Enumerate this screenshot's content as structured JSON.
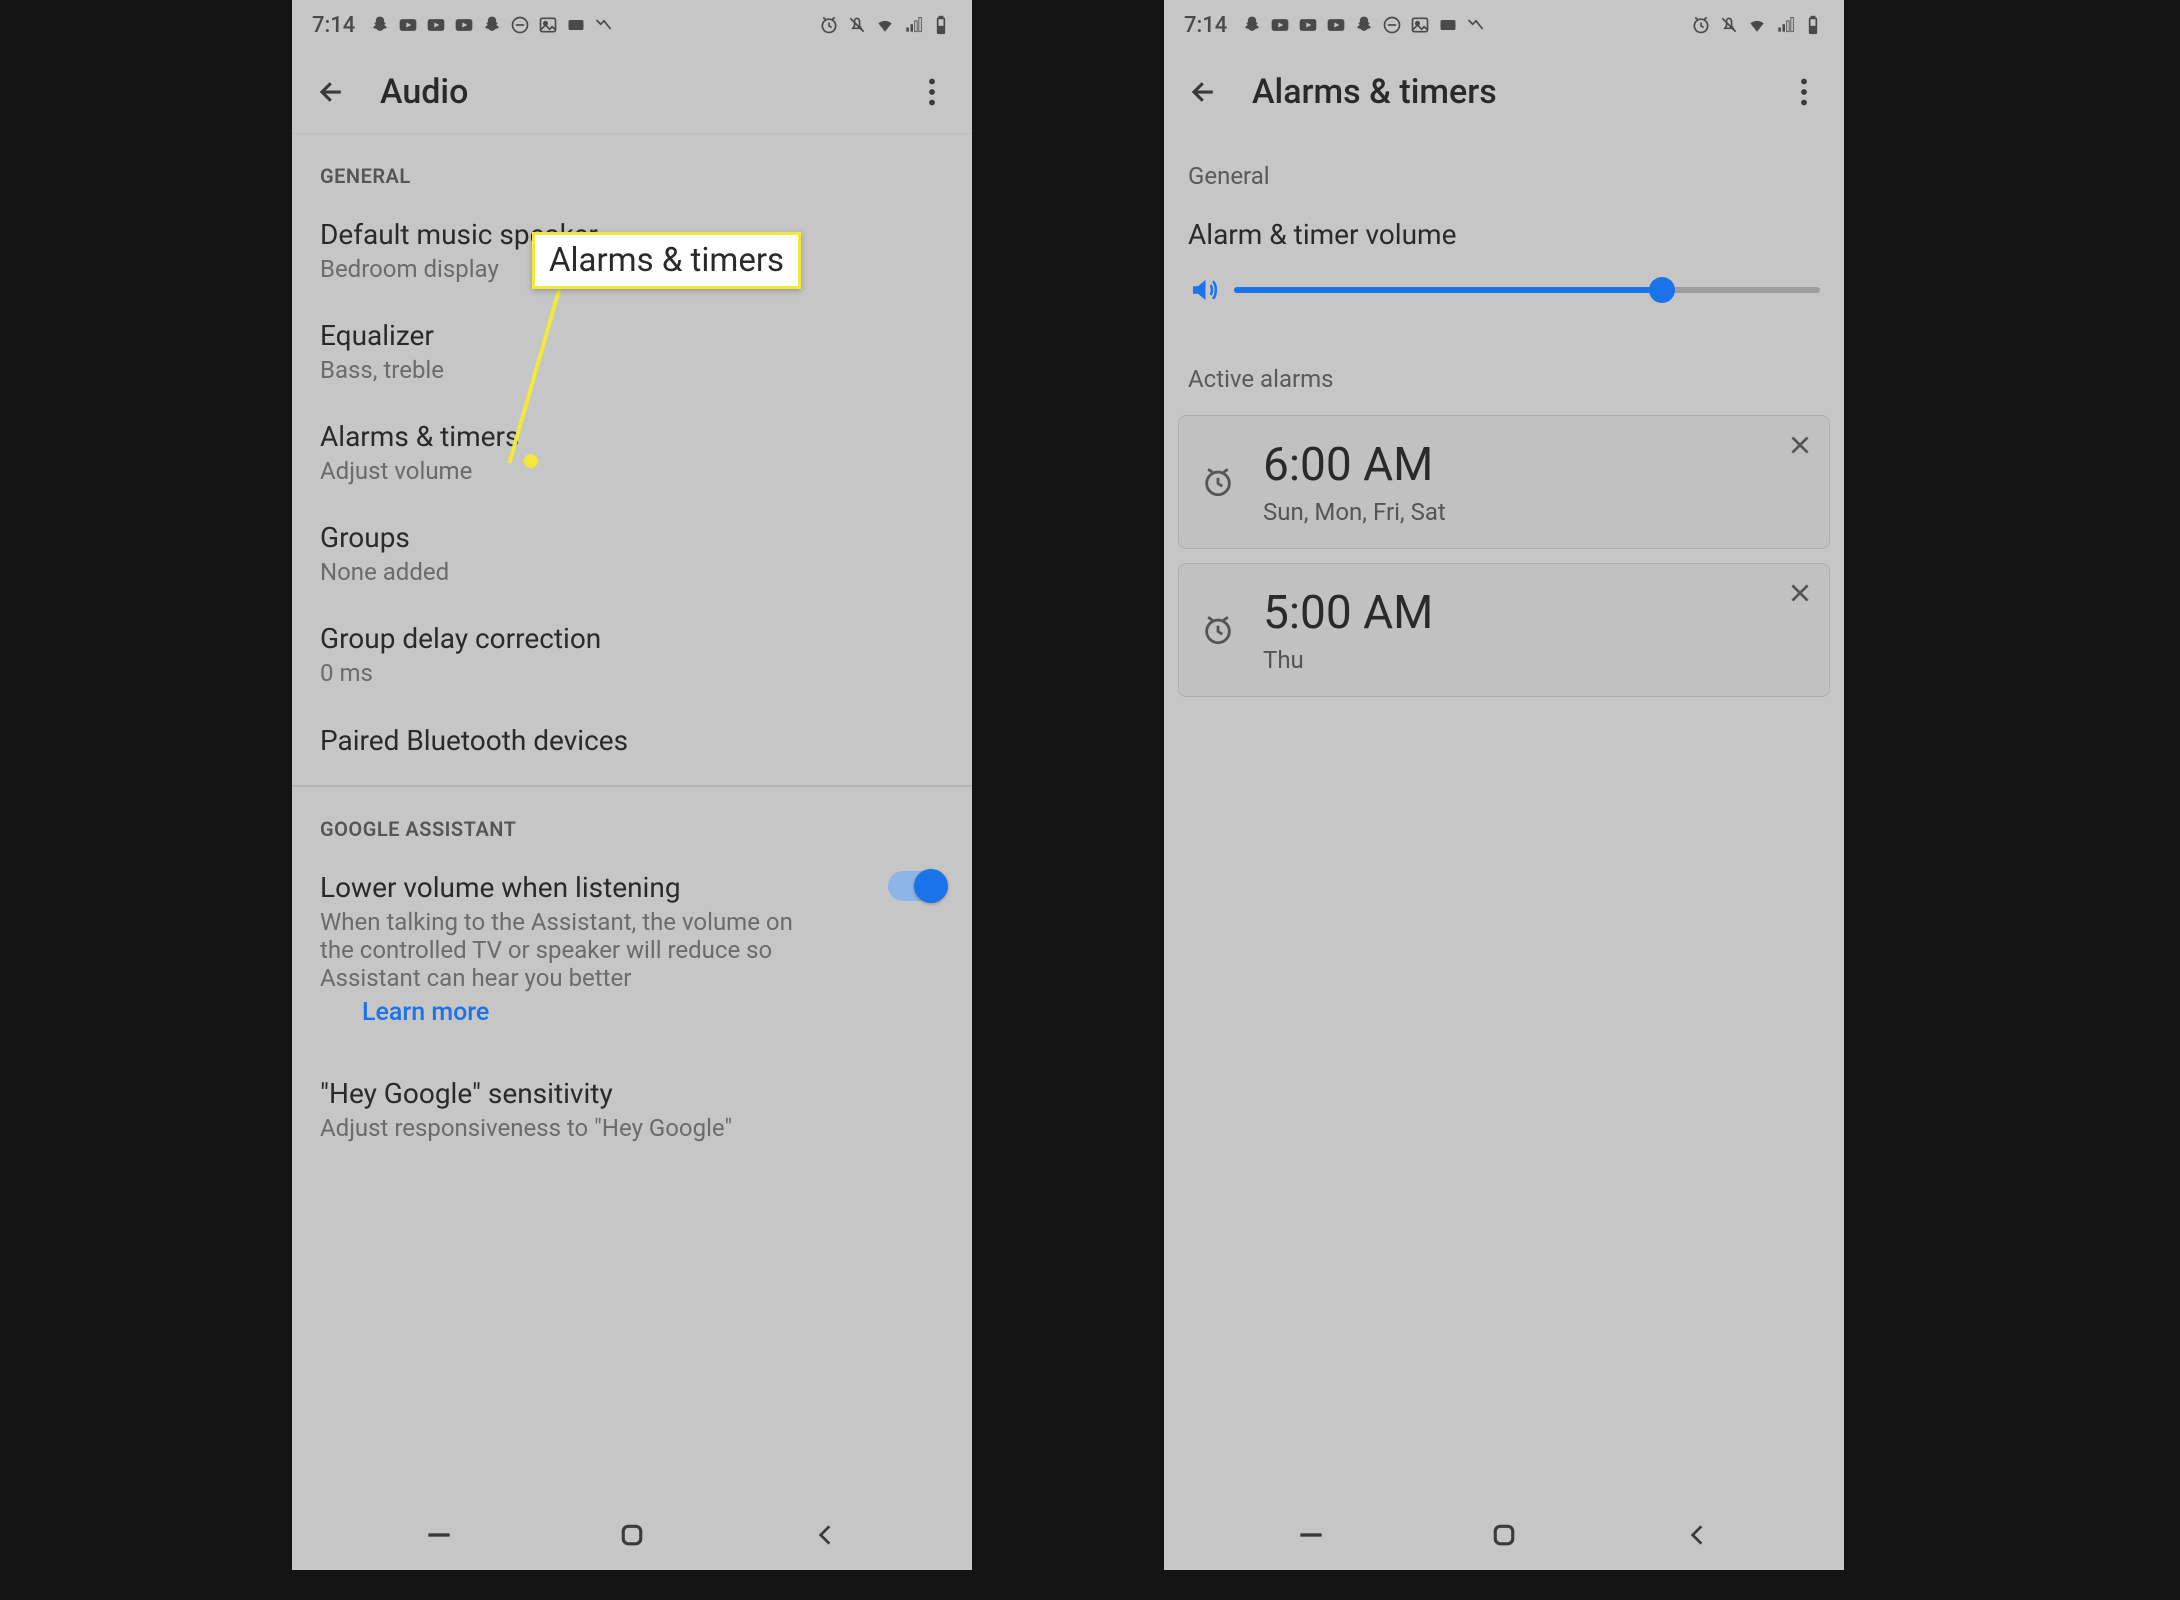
{
  "statusbar": {
    "time": "7:14"
  },
  "left": {
    "header": {
      "title": "Audio"
    },
    "sections": {
      "general_label": "GENERAL",
      "items": [
        {
          "title": "Default music speaker",
          "sub": "Bedroom display"
        },
        {
          "title": "Equalizer",
          "sub": "Bass, treble"
        },
        {
          "title": "Alarms & timers",
          "sub": "Adjust volume"
        },
        {
          "title": "Groups",
          "sub": "None added"
        },
        {
          "title": "Group delay correction",
          "sub": "0 ms"
        },
        {
          "title": "Paired Bluetooth devices",
          "sub": ""
        }
      ],
      "assistant_label": "GOOGLE ASSISTANT",
      "lower_volume": {
        "title": "Lower volume when listening",
        "sub": "When talking to the Assistant, the volume on the controlled TV or speaker will reduce so Assistant can hear you better",
        "learn_more": "Learn more"
      },
      "hey_google": {
        "title": "\"Hey Google\" sensitivity",
        "sub": "Adjust responsiveness to \"Hey Google\""
      }
    }
  },
  "right": {
    "header": {
      "title": "Alarms & timers"
    },
    "general_label": "General",
    "volume_title": "Alarm & timer volume",
    "volume_percent": 73,
    "active_label": "Active alarms",
    "alarms": [
      {
        "time": "6:00 AM",
        "days": "Sun, Mon, Fri, Sat"
      },
      {
        "time": "5:00 AM",
        "days": "Thu"
      }
    ]
  },
  "callout": {
    "text": "Alarms & timers"
  }
}
